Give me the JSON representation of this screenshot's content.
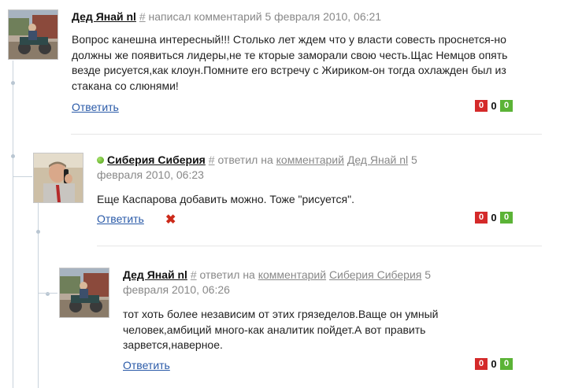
{
  "comments": [
    {
      "author": "Дед Янай nl",
      "hash": "#",
      "meta": "написал комментарий 5 февраля 2010, 06:21",
      "body": "Вопрос канешна интересный!!! Столько лет ждем что у власти совесть проснется-но должны же появиться лидеры,не те кторые заморали свою честь.Щас Немцов опять везде рисуется,как клоун.Помните его встречу с Жириком-он тогда охлажден был из стакана со слюнями!",
      "reply_label": "Ответить",
      "votes": {
        "down": "0",
        "score": "0",
        "up": "0"
      }
    },
    {
      "author": "Сиберия Сиберия",
      "hash": "#",
      "replied_prefix": "ответил на",
      "replied_link1": "комментарий",
      "replied_to": "Дед Янай nl",
      "date_line1": "5",
      "date_line2": "февраля 2010, 06:23",
      "body": "Еще Каспарова добавить можно. Тоже \"рисуется\".",
      "reply_label": "Ответить",
      "delete_icon": "✖",
      "votes": {
        "down": "0",
        "score": "0",
        "up": "0"
      }
    },
    {
      "author": "Дед Янай nl",
      "hash": "#",
      "replied_prefix": "ответил на",
      "replied_link1": "комментарий",
      "replied_to": "Сиберия Сиберия",
      "date_line1": "5",
      "date_line2": "февраля 2010, 06:26",
      "body": "тот хоть более независим от этих грязеделов.Ваще он умный человек,амбиций много-как аналитик пойдет.А вот править зарвется,наверное.",
      "reply_label": "Ответить",
      "votes": {
        "down": "0",
        "score": "0",
        "up": "0"
      }
    }
  ]
}
